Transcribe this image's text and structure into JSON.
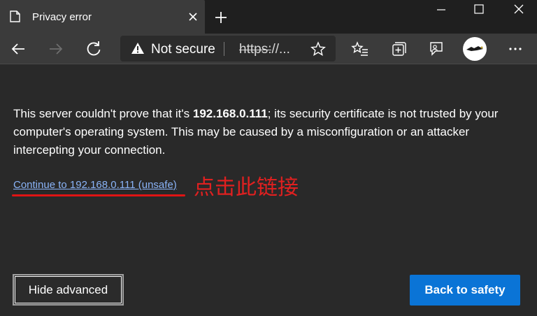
{
  "tab": {
    "title": "Privacy error"
  },
  "addressbar": {
    "security_label": "Not secure",
    "url": "https://..."
  },
  "message": {
    "part1": "This server couldn't prove that it's ",
    "host": "192.168.0.111",
    "part2": "; its security certificate is not trusted by your computer's operating system. This may be caused by a misconfiguration or an attacker intercepting your connection."
  },
  "continue_link": "Continue to 192.168.0.111 (unsafe)",
  "annotation": "点击此链接",
  "buttons": {
    "hide_advanced": "Hide advanced",
    "back_to_safety": "Back to safety"
  },
  "colors": {
    "link": "#8ab4f8",
    "annotation": "#e02020",
    "primary_button": "#0a74d6",
    "background": "#292929"
  }
}
